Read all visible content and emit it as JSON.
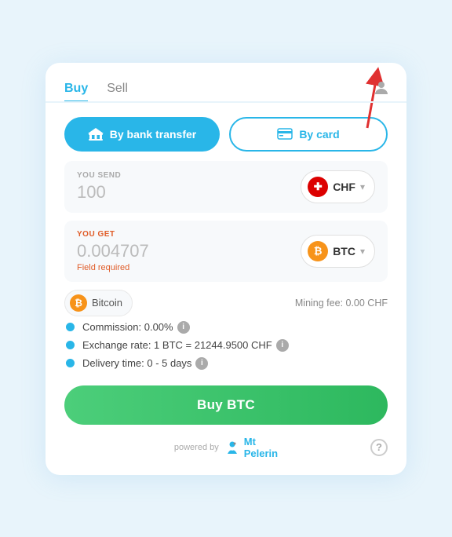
{
  "tabs": {
    "buy": "Buy",
    "sell": "Sell"
  },
  "payment": {
    "bank_label": "By bank transfer",
    "card_label": "By card"
  },
  "send_field": {
    "label": "YOU SEND",
    "value": "100",
    "currency": "CHF",
    "flag": "🇨🇭"
  },
  "get_field": {
    "label": "YOU GET",
    "value": "0.004707",
    "error": "Field required",
    "currency": "BTC"
  },
  "bitcoin_tag": {
    "name": "Bitcoin"
  },
  "mining_fee": {
    "label": "Mining fee: 0.00 CHF"
  },
  "details": {
    "commission": "Commission: 0.00%",
    "exchange_rate": "Exchange rate: 1 BTC = 21244.9500 CHF",
    "delivery": "Delivery time: 0 - 5 days"
  },
  "buy_button": {
    "label": "Buy BTC"
  },
  "footer": {
    "powered_by": "powered by",
    "brand": "Mt\nPelerin"
  }
}
